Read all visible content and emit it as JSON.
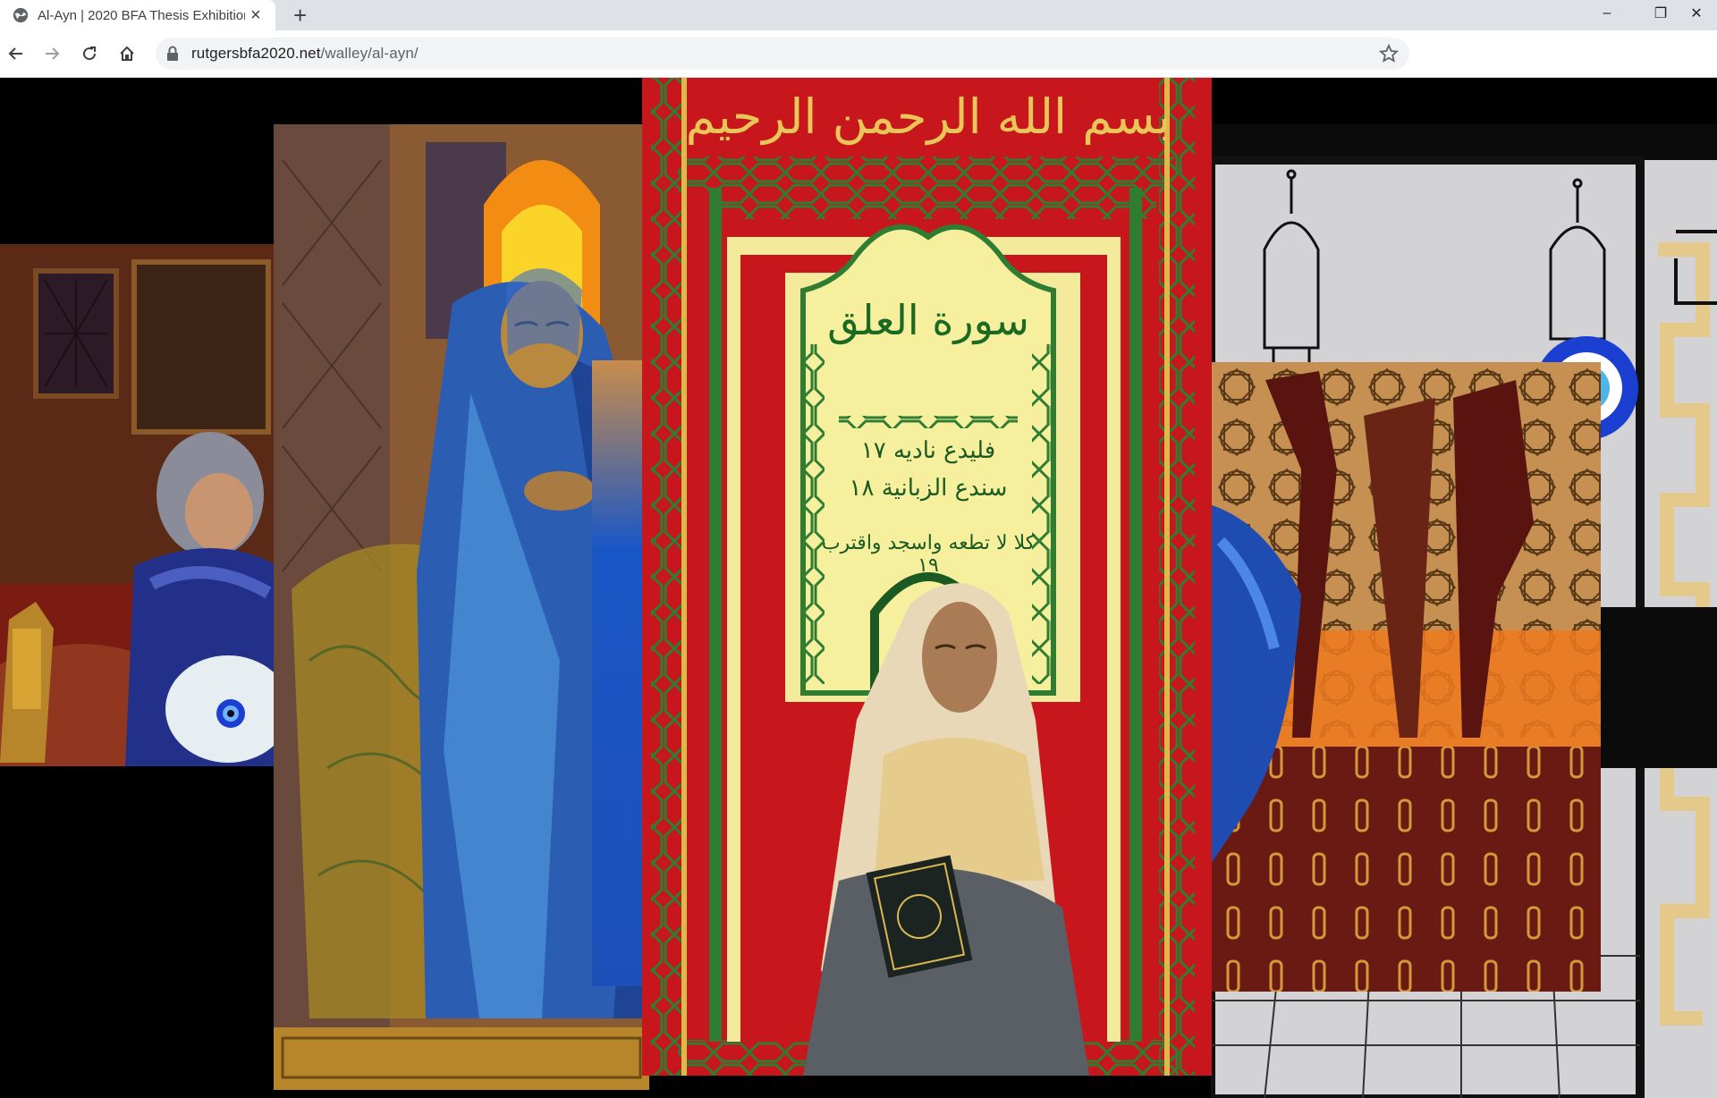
{
  "browser": {
    "tab_title": "Al-Ayn | 2020 BFA Thesis Exhibition",
    "tab_close": "×",
    "new_tab": "+",
    "url_host": "rutgersbfa2020.net",
    "url_path": "/walley/al-ayn/",
    "window_controls": {
      "minimize": "–",
      "maximize": "❐",
      "close": "✕"
    },
    "icons": [
      "globe-icon",
      "back-icon",
      "forward-icon",
      "reload-icon",
      "home-icon",
      "lock-icon",
      "star-icon"
    ]
  },
  "artwork": {
    "panels": [
      {
        "id": "seated-woman-interior"
      },
      {
        "id": "standing-woman-blue"
      },
      {
        "id": "quran-page-surah-al-alaq"
      },
      {
        "id": "minarets-evil-eye"
      },
      {
        "id": "geometric-screen-interior"
      }
    ],
    "calligraphy": {
      "basmala": "بسم الله الرحمن الرحيم",
      "surah_title": "سورة العلق",
      "verse_17": "فليدع ناديه ١٧",
      "verse_18": "سندع الزبانية ١٨",
      "verse_19": "كلا لا تطعه واسجد واقترب ١٩"
    },
    "colors": {
      "page_red": "#c8161d",
      "page_cream": "#f3ea9c",
      "border_green": "#2f7d32",
      "gold": "#e0b84a",
      "robe_blue": "#2b5db3",
      "evil_eye_blue": "#1b3fd0"
    }
  }
}
